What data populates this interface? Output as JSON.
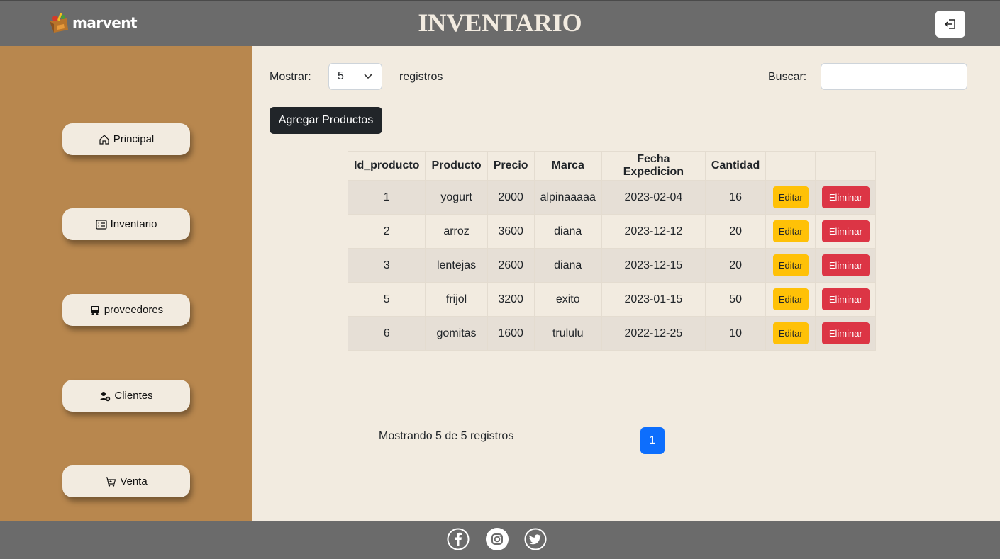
{
  "header": {
    "logo_text": "marvent",
    "title": "INVENTARIO",
    "logout_icon": "logout-icon"
  },
  "sidebar": {
    "items": [
      {
        "label": "Principal",
        "icon": "home-icon"
      },
      {
        "label": "Inventario",
        "icon": "card-list-icon"
      },
      {
        "label": "proveedores",
        "icon": "truck-icon"
      },
      {
        "label": "Clientes",
        "icon": "person-add-icon"
      },
      {
        "label": "Venta",
        "icon": "cart-icon"
      }
    ]
  },
  "controls": {
    "show_label": "Mostrar:",
    "show_value": "5",
    "records_label": "registros",
    "search_label": "Buscar:",
    "search_value": "",
    "add_button": "Agregar Productos"
  },
  "table": {
    "columns": [
      "Id_producto",
      "Producto",
      "Precio",
      "Marca",
      "Fecha Expedicion",
      "Cantidad",
      "",
      ""
    ],
    "rows": [
      [
        "1",
        "yogurt",
        "2000",
        "alpinaaaaa",
        "2023-02-04",
        "16"
      ],
      [
        "2",
        "arroz",
        "3600",
        "diana",
        "2023-12-12",
        "20"
      ],
      [
        "3",
        "lentejas",
        "2600",
        "diana",
        "2023-12-15",
        "20"
      ],
      [
        "5",
        "frijol",
        "3200",
        "exito",
        "2023-01-15",
        "50"
      ],
      [
        "6",
        "gomitas",
        "1600",
        "trululu",
        "2022-12-25",
        "10"
      ]
    ],
    "edit_label": "Editar",
    "delete_label": "Eliminar"
  },
  "pagination": {
    "info": "Mostrando 5 de 5 registros",
    "current_page": "1"
  },
  "footer": {
    "social_icons": [
      "facebook-icon",
      "instagram-icon",
      "twitter-icon"
    ]
  },
  "colors": {
    "header_bg": "#6b6b6b",
    "sidebar_bg": "#b8874e",
    "page_bg": "#f2ebe0",
    "edit_btn": "#ffc107",
    "delete_btn": "#dc3545",
    "page_btn": "#0d6efd"
  }
}
